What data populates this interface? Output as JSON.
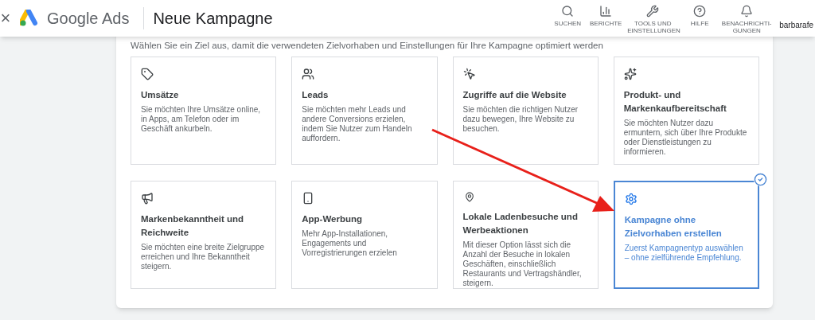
{
  "header": {
    "close": "×",
    "product": "Google Ads",
    "title": "Neue Kampagne",
    "nav": [
      {
        "kind": "search",
        "label": "SUCHEN"
      },
      {
        "kind": "reports",
        "label": "BERICHTE"
      },
      {
        "kind": "tools",
        "label": "TOOLS UND EINSTELLUNGEN"
      },
      {
        "kind": "help",
        "label": "HILFE"
      },
      {
        "kind": "bell",
        "label": "BENACHRICHTI-GUNGEN"
      }
    ],
    "user": "barbarafe"
  },
  "intro": "Wählen Sie ein Ziel aus, damit die verwendeten Zielvorhaben und Einstellungen für Ihre Kampagne optimiert werden",
  "goals": [
    {
      "kind": "tag",
      "title": "Umsätze",
      "description": "Sie möchten Ihre Umsätze online, in Apps, am Telefon oder im Geschäft ankurbeln.",
      "selected": false
    },
    {
      "kind": "people",
      "title": "Leads",
      "description": "Sie möchten mehr Leads und andere Conversions erzielen, indem Sie Nutzer zum Handeln auffordern.",
      "selected": false
    },
    {
      "kind": "click",
      "title": "Zugriffe auf die Website",
      "description": "Sie möchten die richtigen Nutzer dazu bewegen, Ihre Website zu besuchen.",
      "selected": false
    },
    {
      "kind": "sparkles",
      "title": "Produkt- und Markenkaufbereitschaft",
      "description": "Sie möchten Nutzer dazu ermuntern, sich über Ihre Produkte oder Dienstleistungen zu informieren.",
      "selected": false
    },
    {
      "kind": "megaphone",
      "title": "Markenbekanntheit und Reichweite",
      "description": "Sie möchten eine breite Zielgruppe erreichen und Ihre Bekanntheit steigern.",
      "selected": false
    },
    {
      "kind": "phone",
      "title": "App-Werbung",
      "description": "Mehr App-Installationen, Engagements und Vorregistrierungen erzielen",
      "selected": false
    },
    {
      "kind": "pin",
      "title": "Lokale Ladenbesuche und Werbeaktionen",
      "description": "Mit dieser Option lässt sich die Anzahl der Besuche in lokalen Geschäften, einschließlich Restaurants und Vertragshändler, steigern.",
      "selected": false
    },
    {
      "kind": "gear",
      "title": "Kampagne ohne Zielvorhaben erstellen",
      "description": "Zuerst Kampagnentyp auswählen – ohne zielführende Empfehlung.",
      "selected": true
    }
  ]
}
